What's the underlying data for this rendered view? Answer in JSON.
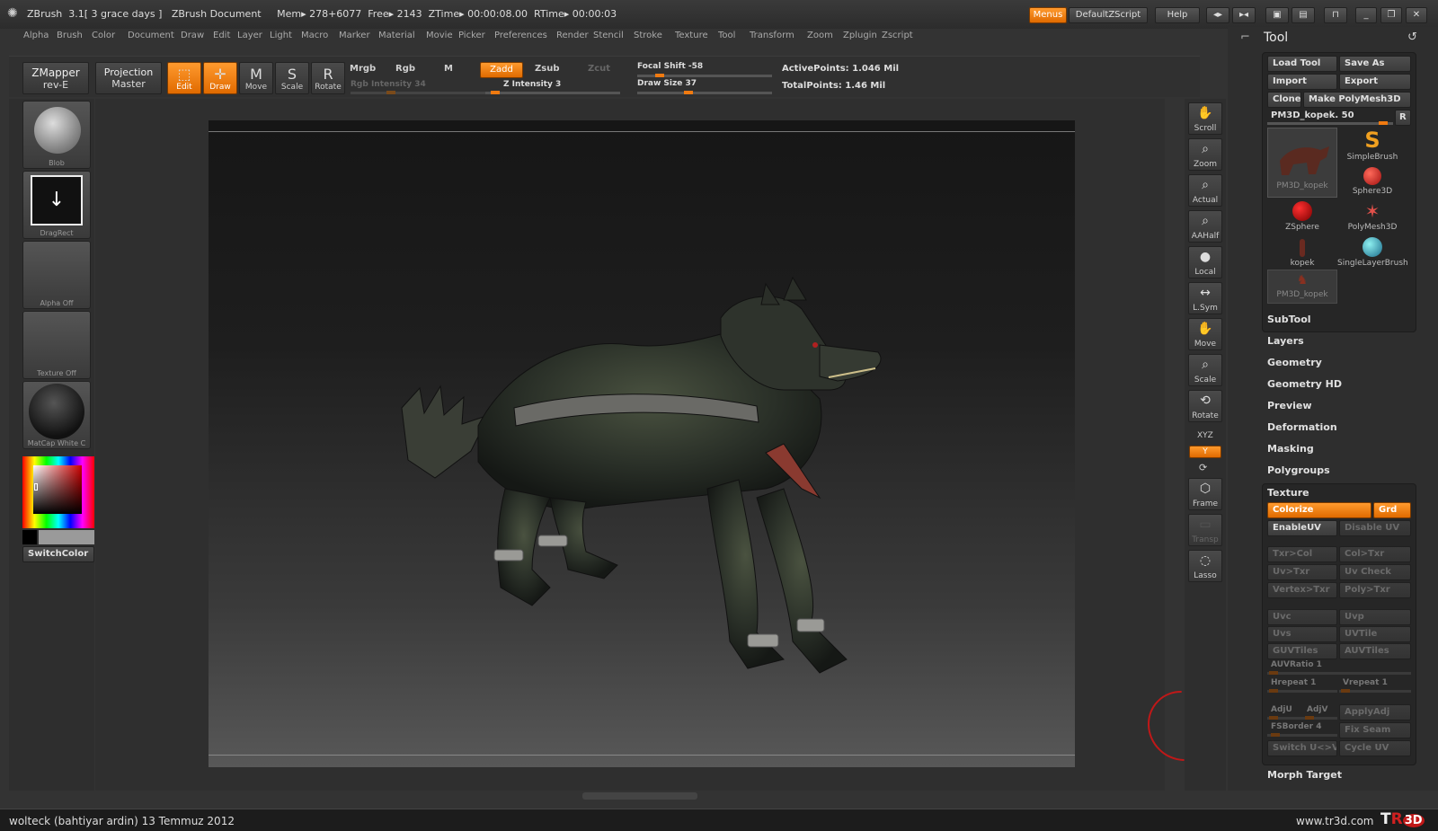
{
  "titlebar": {
    "title": "ZBrush  3.1[ 3 grace days ]   ZBrush Document     Mem▸ 278+6077  Free▸ 2143  ZTime▸ 00:00:08.00  RTime▸ 00:00:03",
    "menus_label": "Menus",
    "zscript_label": "DefaultZScript",
    "help_label": "Help"
  },
  "menubar": {
    "items": [
      "Alpha",
      "Brush",
      "Color",
      "Document",
      "Draw",
      "Edit",
      "Layer",
      "Light",
      "Macro",
      "Marker",
      "Material",
      "Movie",
      "Picker",
      "Preferences",
      "Render",
      "Stencil",
      "Stroke",
      "Texture",
      "Tool",
      "Transform",
      "Zoom",
      "Zplugin",
      "Zscript"
    ]
  },
  "toolbar": {
    "zmapper": "ZMapper",
    "zmapper_sub": "rev-E",
    "projection": "Projection",
    "projection_sub": "Master",
    "edit": "Edit",
    "draw": "Draw",
    "move": "Move",
    "scale": "Scale",
    "rotate": "Rotate",
    "mrgb": "Mrgb",
    "rgb": "Rgb",
    "m": "M",
    "rgb_intensity": "Rgb  Intensity 34",
    "zadd": "Zadd",
    "zsub": "Zsub",
    "zcut": "Zcut",
    "z_intensity": "Z  Intensity 3",
    "focal_shift": "Focal  Shift -58",
    "draw_size": "Draw  Size 37",
    "active_points": "ActivePoints: 1.046  Mil",
    "total_points": "TotalPoints: 1.46  Mil"
  },
  "leftshelf": {
    "blob": "Blob",
    "dragrect": "DragRect",
    "alpha_off": "Alpha  Off",
    "texture_off": "Texture  Off",
    "matcap": "MatCap  White  C",
    "switchcolor": "SwitchColor"
  },
  "rightshelf": {
    "scroll": "Scroll",
    "zoom": "Zoom",
    "actual": "Actual",
    "aahalf": "AAHalf",
    "local": "Local",
    "lsym": "L.Sym",
    "move": "Move",
    "scale": "Scale",
    "rotate": "Rotate",
    "xyz": "XYZ",
    "y": "Y",
    "frame": "Frame",
    "transp": "Transp",
    "lasso": "Lasso"
  },
  "toolpanel": {
    "title": "Tool",
    "load_tool": "Load Tool",
    "save_as": "Save As",
    "import": "Import",
    "export": "Export",
    "clone": "Clone",
    "make_polymesh": "Make PolyMesh3D",
    "current_tool": "PM3D_kopek. 50",
    "r": "R",
    "thumbs": [
      "PM3D_kopek",
      "SimpleBrush",
      "Sphere3D",
      "ZSphere",
      "PolyMesh3D",
      "kopek",
      "SingleLayerBrush",
      "PM3D_kopek"
    ],
    "sections": [
      "SubTool",
      "Layers",
      "Geometry",
      "Geometry HD",
      "Preview",
      "Deformation",
      "Masking",
      "Polygroups"
    ],
    "texture": "Texture",
    "colorize": "Colorize",
    "grd": "Grd",
    "enableuv": "EnableUV",
    "disable_uv": "Disable  UV",
    "txr_col": "Txr>Col",
    "col_txr": "Col>Txr",
    "uv_txr": "Uv>Txr",
    "uv_check": "Uv  Check",
    "vertex_txr": "Vertex>Txr",
    "poly_txr": "Poly>Txr",
    "uvc": "Uvc",
    "uvp": "Uvp",
    "uvs": "Uvs",
    "uvtile": "UVTile",
    "guvtiles": "GUVTiles",
    "auvtiles": "AUVTiles",
    "auvratio": "AUVRatio 1",
    "hrepeat": "Hrepeat 1",
    "vrepeat": "Vrepeat 1",
    "adju": "AdjU",
    "adjv": "AdjV",
    "applyadj": "ApplyAdj",
    "fsborder": "FSBorder 4",
    "fix_seam": "Fix  Seam",
    "switch_uv": "Switch  U<>V",
    "cycle_uv": "Cycle  UV",
    "morph_target": "Morph Target"
  },
  "statusbar": {
    "left": "wolteck (bahtiyar ardin)  13 Temmuz 2012",
    "right": "www.tr3d.com"
  },
  "colors": {
    "accent": "#f07a10",
    "bg": "#333333"
  }
}
